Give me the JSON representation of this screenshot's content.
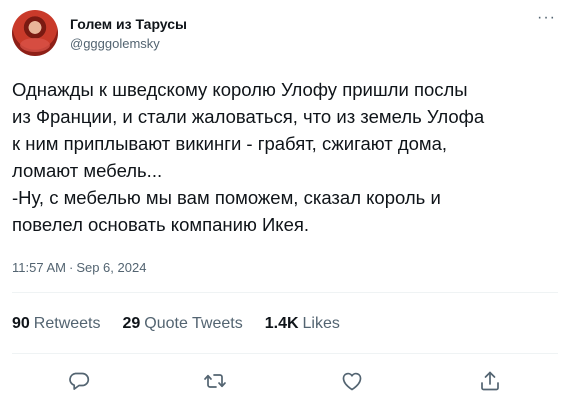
{
  "user": {
    "display_name": "Голем из Тарусы",
    "handle": "@ggggolemsky"
  },
  "header": {
    "more_label": "···"
  },
  "tweet": {
    "text": "Однажды к шведскому королю Улофу пришли послы\nиз Франции, и стали жаловаться, что из земель Улофа\nк ним приплывают викинги - грабят, сжигают дома,\nломают мебель...\n-Ну, с мебелью мы вам поможем, сказал король и\nповелел основать компанию Икея.",
    "time": "11:57 AM",
    "separator": "·",
    "date": "Sep 6, 2024"
  },
  "stats": {
    "retweets": {
      "count": "90",
      "label": "Retweets"
    },
    "quote_tweets": {
      "count": "29",
      "label": "Quote Tweets"
    },
    "likes": {
      "count": "1.4K",
      "label": "Likes"
    }
  },
  "actions": [
    {
      "icon": "reply-icon"
    },
    {
      "icon": "retweet-icon"
    },
    {
      "icon": "like-icon"
    },
    {
      "icon": "share-icon"
    }
  ],
  "colors": {
    "text_primary": "#0f1419",
    "text_secondary": "#536471",
    "divider": "#eff3f4"
  }
}
